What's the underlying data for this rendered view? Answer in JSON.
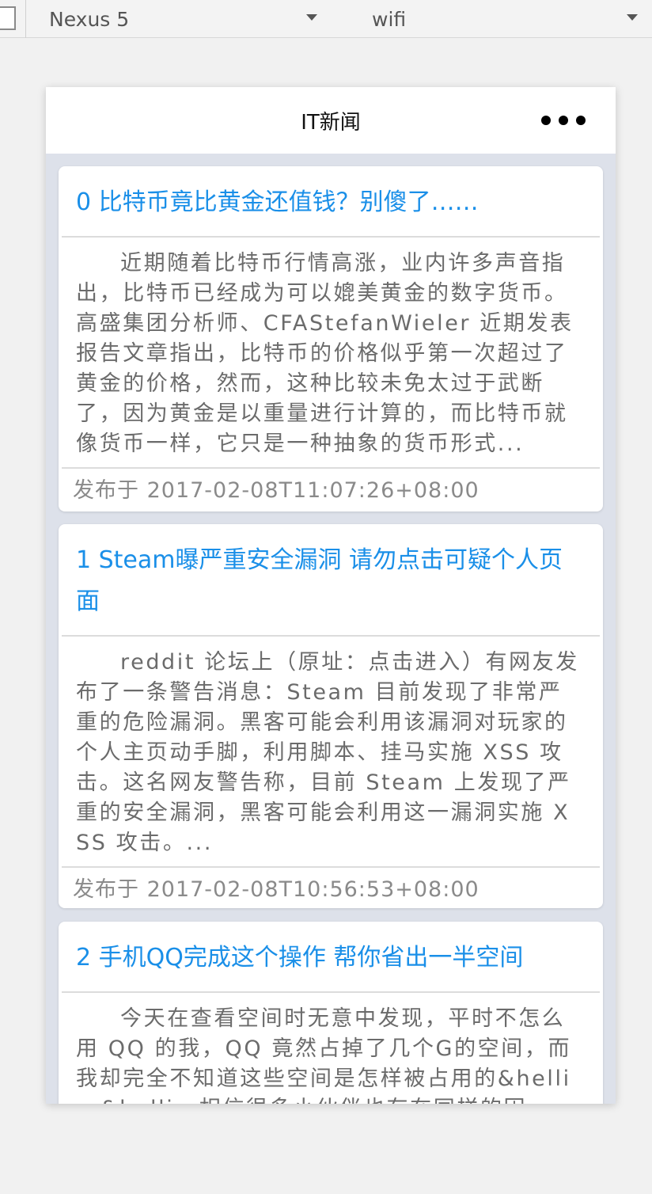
{
  "toolbar": {
    "device": "Nexus 5",
    "network": "wifi"
  },
  "app": {
    "title": "IT新闻"
  },
  "articles": [
    {
      "title": "0 比特币竟比黄金还值钱？别傻了……",
      "summary": "近期随着比特币行情高涨，业内许多声音指出，比特币已经成为可以媲美黄金的数字货币。高盛集团分析师、CFAStefanWieler 近期发表报告文章指出，比特币的价格似乎第一次超过了黄金的价格，然而，这种比较未免太过于武断了，因为黄金是以重量进行计算的，而比特币就像货币一样，它只是一种抽象的货币形式...",
      "date": "发布于 2017-02-08T11:07:26+08:00"
    },
    {
      "title": "1 Steam曝严重安全漏洞 请勿点击可疑个人页面",
      "summary": "reddit 论坛上（原址：点击进入）有网友发布了一条警告消息：Steam 目前发现了非常严重的危险漏洞。黑客可能会利用该漏洞对玩家的个人主页动手脚，利用脚本、挂马实施 XSS 攻击。这名网友警告称，目前 Steam 上发现了严重的安全漏洞，黑客可能会利用这一漏洞实施 XSS 攻击。...",
      "date": "发布于 2017-02-08T10:56:53+08:00"
    },
    {
      "title": "2 手机QQ完成这个操作 帮你省出一半空间",
      "summary": "今天在查看空间时无意中发现，平时不怎么用 QQ 的我，QQ 竟然占掉了几个G的空间，而我却完全不知道这些空间是怎样被占用的&hellip;&hellip;相信很多小伙伴也存在同样的困",
      "date": ""
    }
  ],
  "colors": {
    "title": "#1a8fe8",
    "body": "#6b6b6b",
    "background": "#dde1ea"
  }
}
